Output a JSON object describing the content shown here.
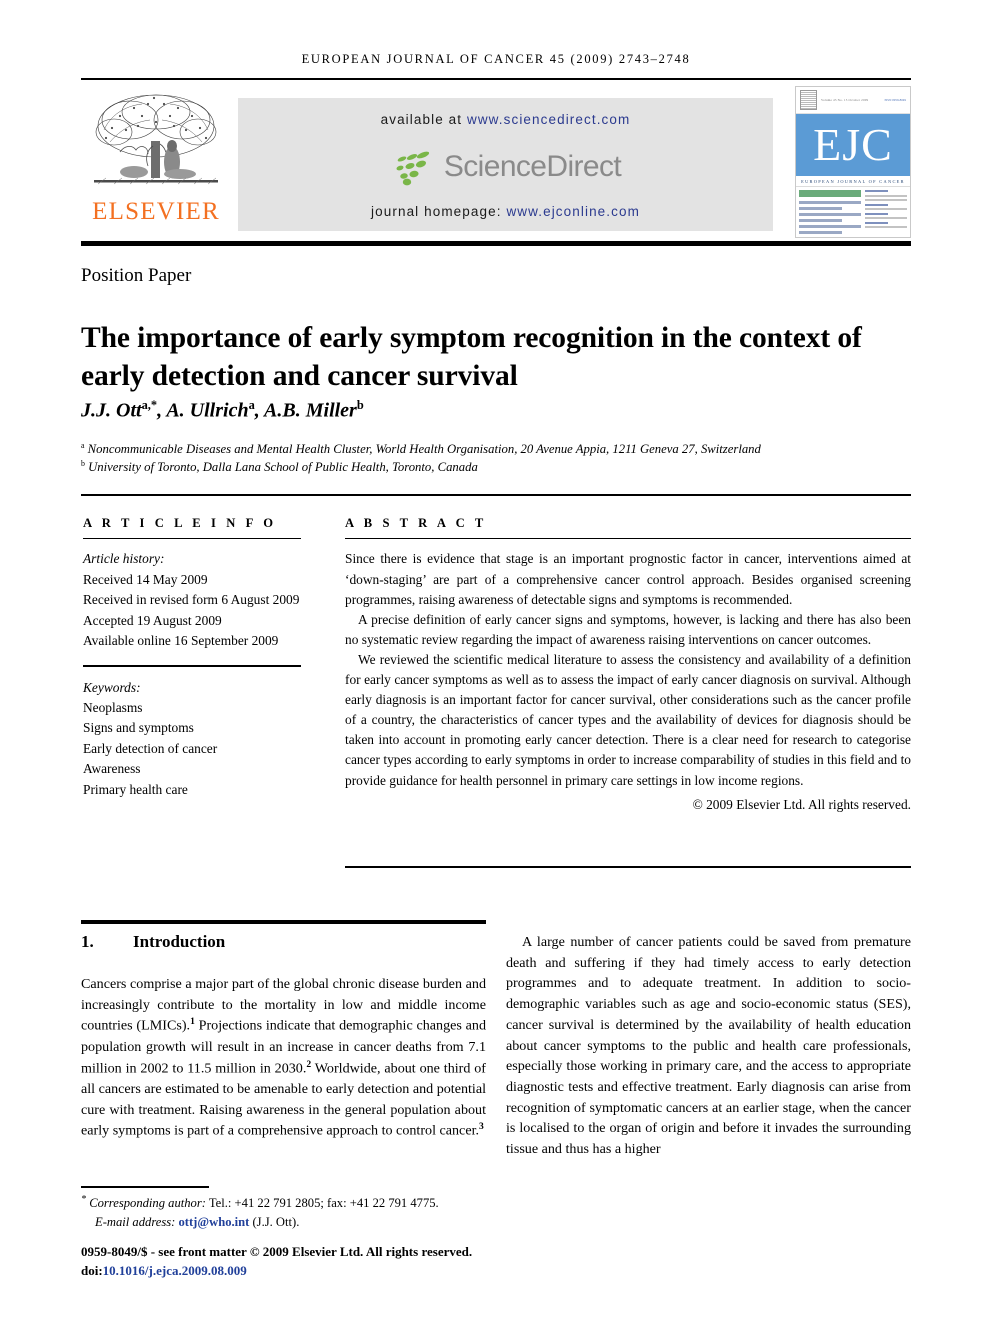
{
  "running_head": "EUROPEAN JOURNAL OF CANCER 45 (2009) 2743–2748",
  "masthead": {
    "publisher_name": "ELSEVIER",
    "publisher_color": "#F37021",
    "available_prefix": "available at ",
    "available_link": "www.sciencedirect.com",
    "sciencedirect_wordmark": "ScienceDirect",
    "homepage_prefix": "journal homepage: ",
    "homepage_link": "www.ejconline.com",
    "link_color": "#2b3a8f",
    "banner_bg": "#e3e3e3",
    "cover": {
      "acronym": "EJC",
      "journal_name": "EUROPEAN JOURNAL OF CANCER",
      "band_color": "#5b9bd5",
      "accent_color": "#6aab7a",
      "top_line": "Volume 45  No. 15  October 2009",
      "issn_text": "ISSN 0959-8049"
    }
  },
  "article": {
    "type": "Position Paper",
    "title": "The importance of early symptom recognition in the context of early detection and cancer survival",
    "authors": "J.J. Ott",
    "authors_full": [
      {
        "name": "J.J. Ott",
        "marks": "a,*"
      },
      {
        "name": "A. Ullrich",
        "marks": "a"
      },
      {
        "name": "A.B. Miller",
        "marks": "b"
      }
    ],
    "affiliations": [
      {
        "mark": "a",
        "text": "Noncommunicable Diseases and Mental Health Cluster, World Health Organisation, 20 Avenue Appia, 1211 Geneva 27, Switzerland"
      },
      {
        "mark": "b",
        "text": "University of Toronto, Dalla Lana School of Public Health, Toronto, Canada"
      }
    ]
  },
  "info": {
    "heading": "A R T I C L E   I N F O",
    "history_label": "Article history:",
    "history": [
      "Received 14 May 2009",
      "Received in revised form 6 August 2009",
      "Accepted 19 August 2009",
      "Available online 16 September 2009"
    ],
    "keywords_label": "Keywords:",
    "keywords": [
      "Neoplasms",
      "Signs and symptoms",
      "Early detection of cancer",
      "Awareness",
      "Primary health care"
    ]
  },
  "abstract": {
    "heading": "A B S T R A C T",
    "paragraphs": [
      "Since there is evidence that stage is an important prognostic factor in cancer, interventions aimed at ‘down-staging’ are part of a comprehensive cancer control approach. Besides organised screening programmes, raising awareness of detectable signs and symptoms is recommended.",
      "A precise definition of early cancer signs and symptoms, however, is lacking and there has also been no systematic review regarding the impact of awareness raising interventions on cancer outcomes.",
      "We reviewed the scientific medical literature to assess the consistency and availability of a definition for early cancer symptoms as well as to assess the impact of early cancer diagnosis on survival. Although early diagnosis is an important factor for cancer survival, other considerations such as the cancer profile of a country, the characteristics of cancer types and the availability of devices for diagnosis should be taken into account in promoting early cancer detection. There is a clear need for research to categorise cancer types according to early symptoms in order to increase comparability of studies in this field and to provide guidance for health personnel in primary care settings in low income regions."
    ],
    "copyright": "© 2009 Elsevier Ltd. All rights reserved."
  },
  "body": {
    "section_number": "1.",
    "section_title": "Introduction",
    "left_paragraph_part1": "Cancers comprise a major part of the global chronic disease burden and increasingly contribute to the mortality in low and middle income countries (LMICs).",
    "cite1": "1",
    "left_paragraph_part2": " Projections indicate that demographic changes and population growth will result in an increase in cancer deaths from 7.1 million in 2002 to 11.5 million in 2030.",
    "cite2": "2",
    "left_paragraph_part3": " Worldwide, about one third of all cancers are estimated to be amenable to early detection and potential cure with treatment. Raising awareness in the general population about early symptoms is part of a comprehensive approach to control cancer.",
    "cite3": "3",
    "right_paragraph": "A large number of cancer patients could be saved from premature death and suffering if they had timely access to early detection programmes and to adequate treatment. In addition to socio-demographic variables such as age and socio-economic status (SES), cancer survival is determined by the availability of health education about cancer symptoms to the public and health care professionals, especially those working in primary care, and the access to appropriate diagnostic tests and effective treatment. Early diagnosis can arise from recognition of symptomatic cancers at an earlier stage, when the cancer is localised to the organ of origin and before it invades the surrounding tissue and thus has a higher"
  },
  "footer": {
    "corresponding_label": "Corresponding author:",
    "corresponding_contact": " Tel.: +41 22 791 2805; fax: +41 22 791 4775.",
    "email_label": "E-mail address:",
    "email": "ottj@who.int",
    "email_owner": " (J.J. Ott).",
    "issn_line": "0959-8049/$ - see front matter © 2009 Elsevier Ltd. All rights reserved.",
    "doi_label": "doi:",
    "doi": "10.1016/j.ejca.2009.08.009",
    "link_color": "#21409a"
  }
}
